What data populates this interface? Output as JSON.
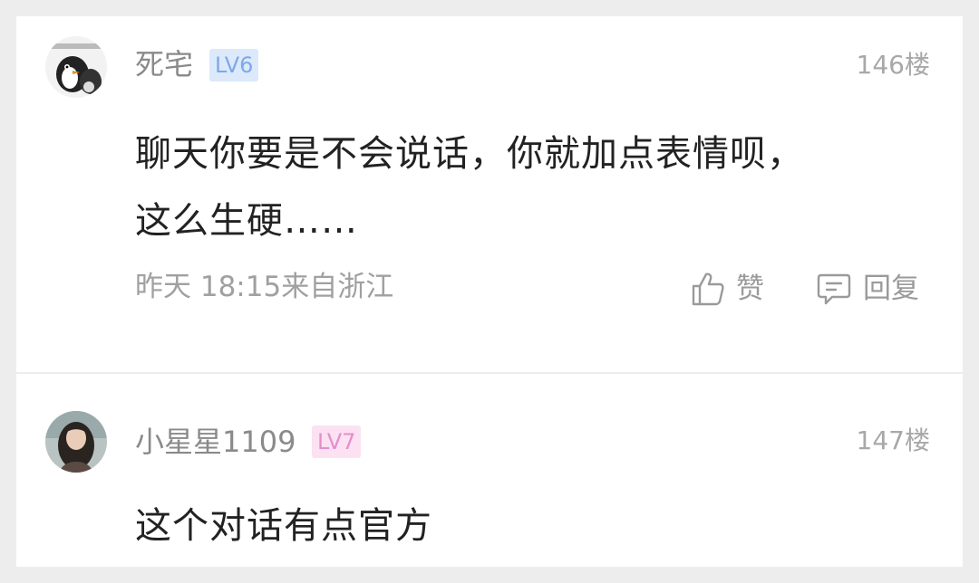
{
  "comments": [
    {
      "username": "死宅",
      "level": "LV6",
      "floor": "146楼",
      "content_lines": [
        "聊天你要是不会说话，你就加点表情呗，",
        "这么生硬……"
      ],
      "time": "昨天 18:15来自浙江",
      "like_label": "赞",
      "reply_label": "回复",
      "avatar_icon": "cartoon-penguin-avatar"
    },
    {
      "username": "小星星1109",
      "level": "LV7",
      "floor": "147楼",
      "content_lines": [
        "这个对话有点官方"
      ],
      "avatar_icon": "person-photo-avatar"
    }
  ],
  "colors": {
    "level_blue_bg": "#dbe9fb",
    "level_blue_text": "#7fa8e6",
    "level_pink_bg": "#fbe1f2",
    "level_pink_text": "#e38fcb"
  }
}
